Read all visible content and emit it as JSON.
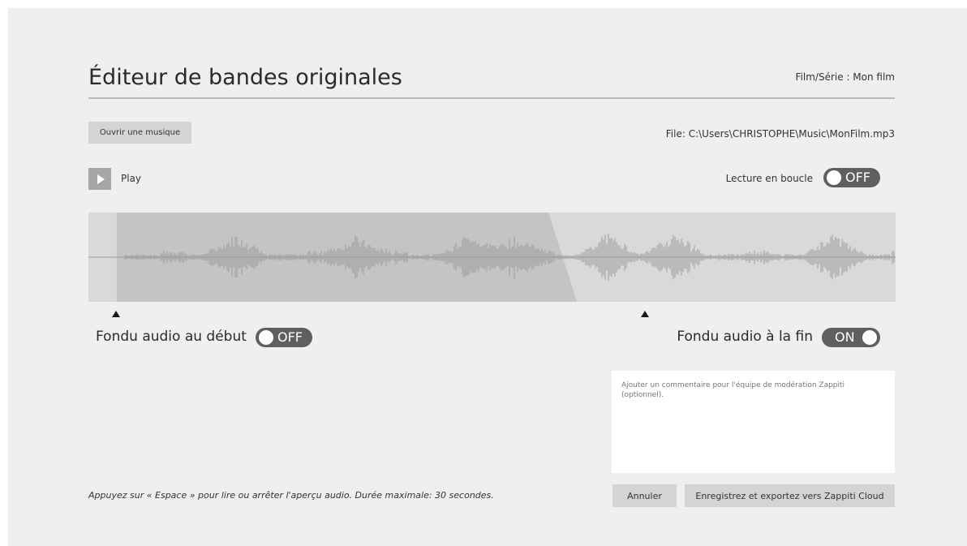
{
  "header": {
    "title": "Éditeur de bandes originales",
    "film": "Film/Série : Mon film"
  },
  "file": {
    "open_button_label": "Ouvrir une musique",
    "path_label": "File: C:\\Users\\CHRISTOPHE\\Music\\MonFilm.mp3"
  },
  "player": {
    "play_label": "Play",
    "loop_label": "Lecture en boucle",
    "loop_state": "OFF"
  },
  "waveform": {
    "selection_start_fraction": 0.035,
    "selection_end_fraction": 0.57,
    "background_color": "#d9d9d9",
    "selection_color": "#c4c4c4",
    "wave_color": "#9a9a9a"
  },
  "fades": {
    "start_label": "Fondu audio au début",
    "start_state": "OFF",
    "end_label": "Fondu audio à la fin",
    "end_state": "ON"
  },
  "comment": {
    "placeholder": "Ajouter un commentaire pour l'équipe de modération Zappiti (optionnel)."
  },
  "footer": {
    "hint": "Appuyez sur « Espace » pour lire ou arrêter l'aperçu audio. Durée maximale: 30 secondes.",
    "cancel_label": "Annuler",
    "export_label": "Enregistrez et exportez vers Zappiti Cloud"
  }
}
